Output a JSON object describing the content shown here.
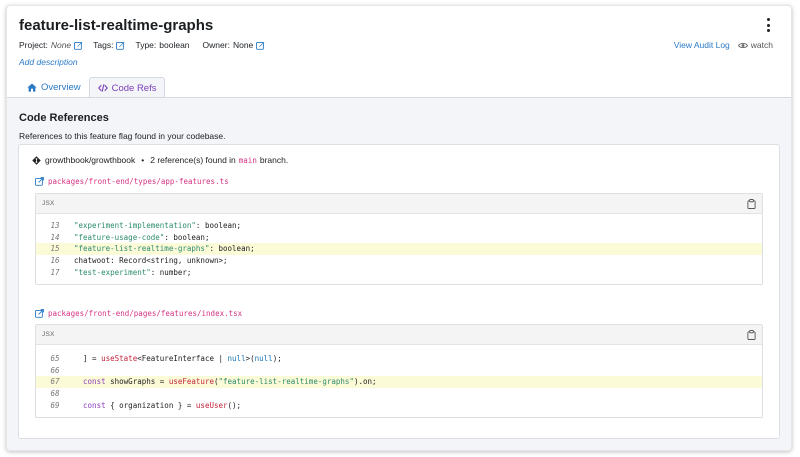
{
  "feature": {
    "title": "feature-list-realtime-graphs",
    "add_description": "Add description"
  },
  "meta": {
    "project_label": "Project:",
    "project_value": "None",
    "tags_label": "Tags:",
    "type_label": "Type:",
    "type_value": "boolean",
    "owner_label": "Owner:",
    "owner_value": "None"
  },
  "actions": {
    "audit_log": "View Audit Log",
    "watch": "watch"
  },
  "tabs": [
    {
      "label": "Overview",
      "icon": "home-icon"
    },
    {
      "label": "Code Refs",
      "icon": "code-icon",
      "active": true
    }
  ],
  "code_refs": {
    "title": "Code References",
    "subtitle": "References to this feature flag found in your codebase.",
    "repo": "growthbook/growthbook",
    "separator": "•",
    "ref_count_text": "2 reference(s) found in",
    "branch": "main",
    "branch_suffix": "branch.",
    "files": [
      {
        "path": "packages/front-end/types/app-features.ts",
        "lang": "JSX",
        "lines": [
          {
            "num": "13",
            "text": "\"experiment-implementation\": boolean;",
            "highlight": false
          },
          {
            "num": "14",
            "text": "\"feature-usage-code\": boolean;",
            "highlight": false
          },
          {
            "num": "15",
            "text": "\"feature-list-realtime-graphs\": boolean;",
            "highlight": true
          },
          {
            "num": "16",
            "text": "chatwoot: Record<string, unknown>;",
            "highlight": false
          },
          {
            "num": "17",
            "text": "\"test-experiment\": number;",
            "highlight": false
          }
        ]
      },
      {
        "path": "packages/front-end/pages/features/index.tsx",
        "lang": "JSX",
        "lines": [
          {
            "num": "65",
            "text": "  ] = useState<FeatureInterface | null>(null);",
            "highlight": false
          },
          {
            "num": "66",
            "text": "",
            "highlight": false
          },
          {
            "num": "67",
            "text": "  const showGraphs = useFeature(\"feature-list-realtime-graphs\").on;",
            "highlight": true
          },
          {
            "num": "68",
            "text": "",
            "highlight": false
          },
          {
            "num": "69",
            "text": "  const { organization } = useUser();",
            "highlight": false
          }
        ]
      }
    ]
  },
  "colors": {
    "link": "#2a7ac7",
    "active_tab": "#7b3fb9",
    "code_path": "#d63384",
    "highlight": "#fcfbd8"
  }
}
